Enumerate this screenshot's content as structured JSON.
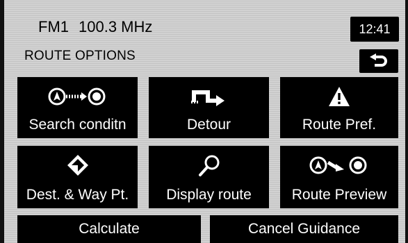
{
  "header": {
    "band": "FM1",
    "frequency": "100.3 MHz",
    "clock": "12:41"
  },
  "page_title": "ROUTE OPTIONS",
  "icons": {
    "back": "back-arrow-icon",
    "search_conditions": "route-start-to-destination-icon",
    "detour": "detour-arrow-icon",
    "route_pref": "warning-triangle-icon",
    "dest_waypoint": "diamond-waypoint-icon",
    "display_route": "magnifier-icon",
    "route_preview": "route-preview-icon"
  },
  "buttons": {
    "search_conditions": "Search conditn",
    "detour": "Detour",
    "route_pref": "Route Pref.",
    "dest_waypoint": "Dest. & Way Pt.",
    "display_route": "Display route",
    "route_preview": "Route Preview",
    "calculate": "Calculate",
    "cancel_guidance": "Cancel Guidance"
  },
  "colors": {
    "background": "#d2d2d2",
    "button": "#000000",
    "button_text": "#ffffff"
  }
}
